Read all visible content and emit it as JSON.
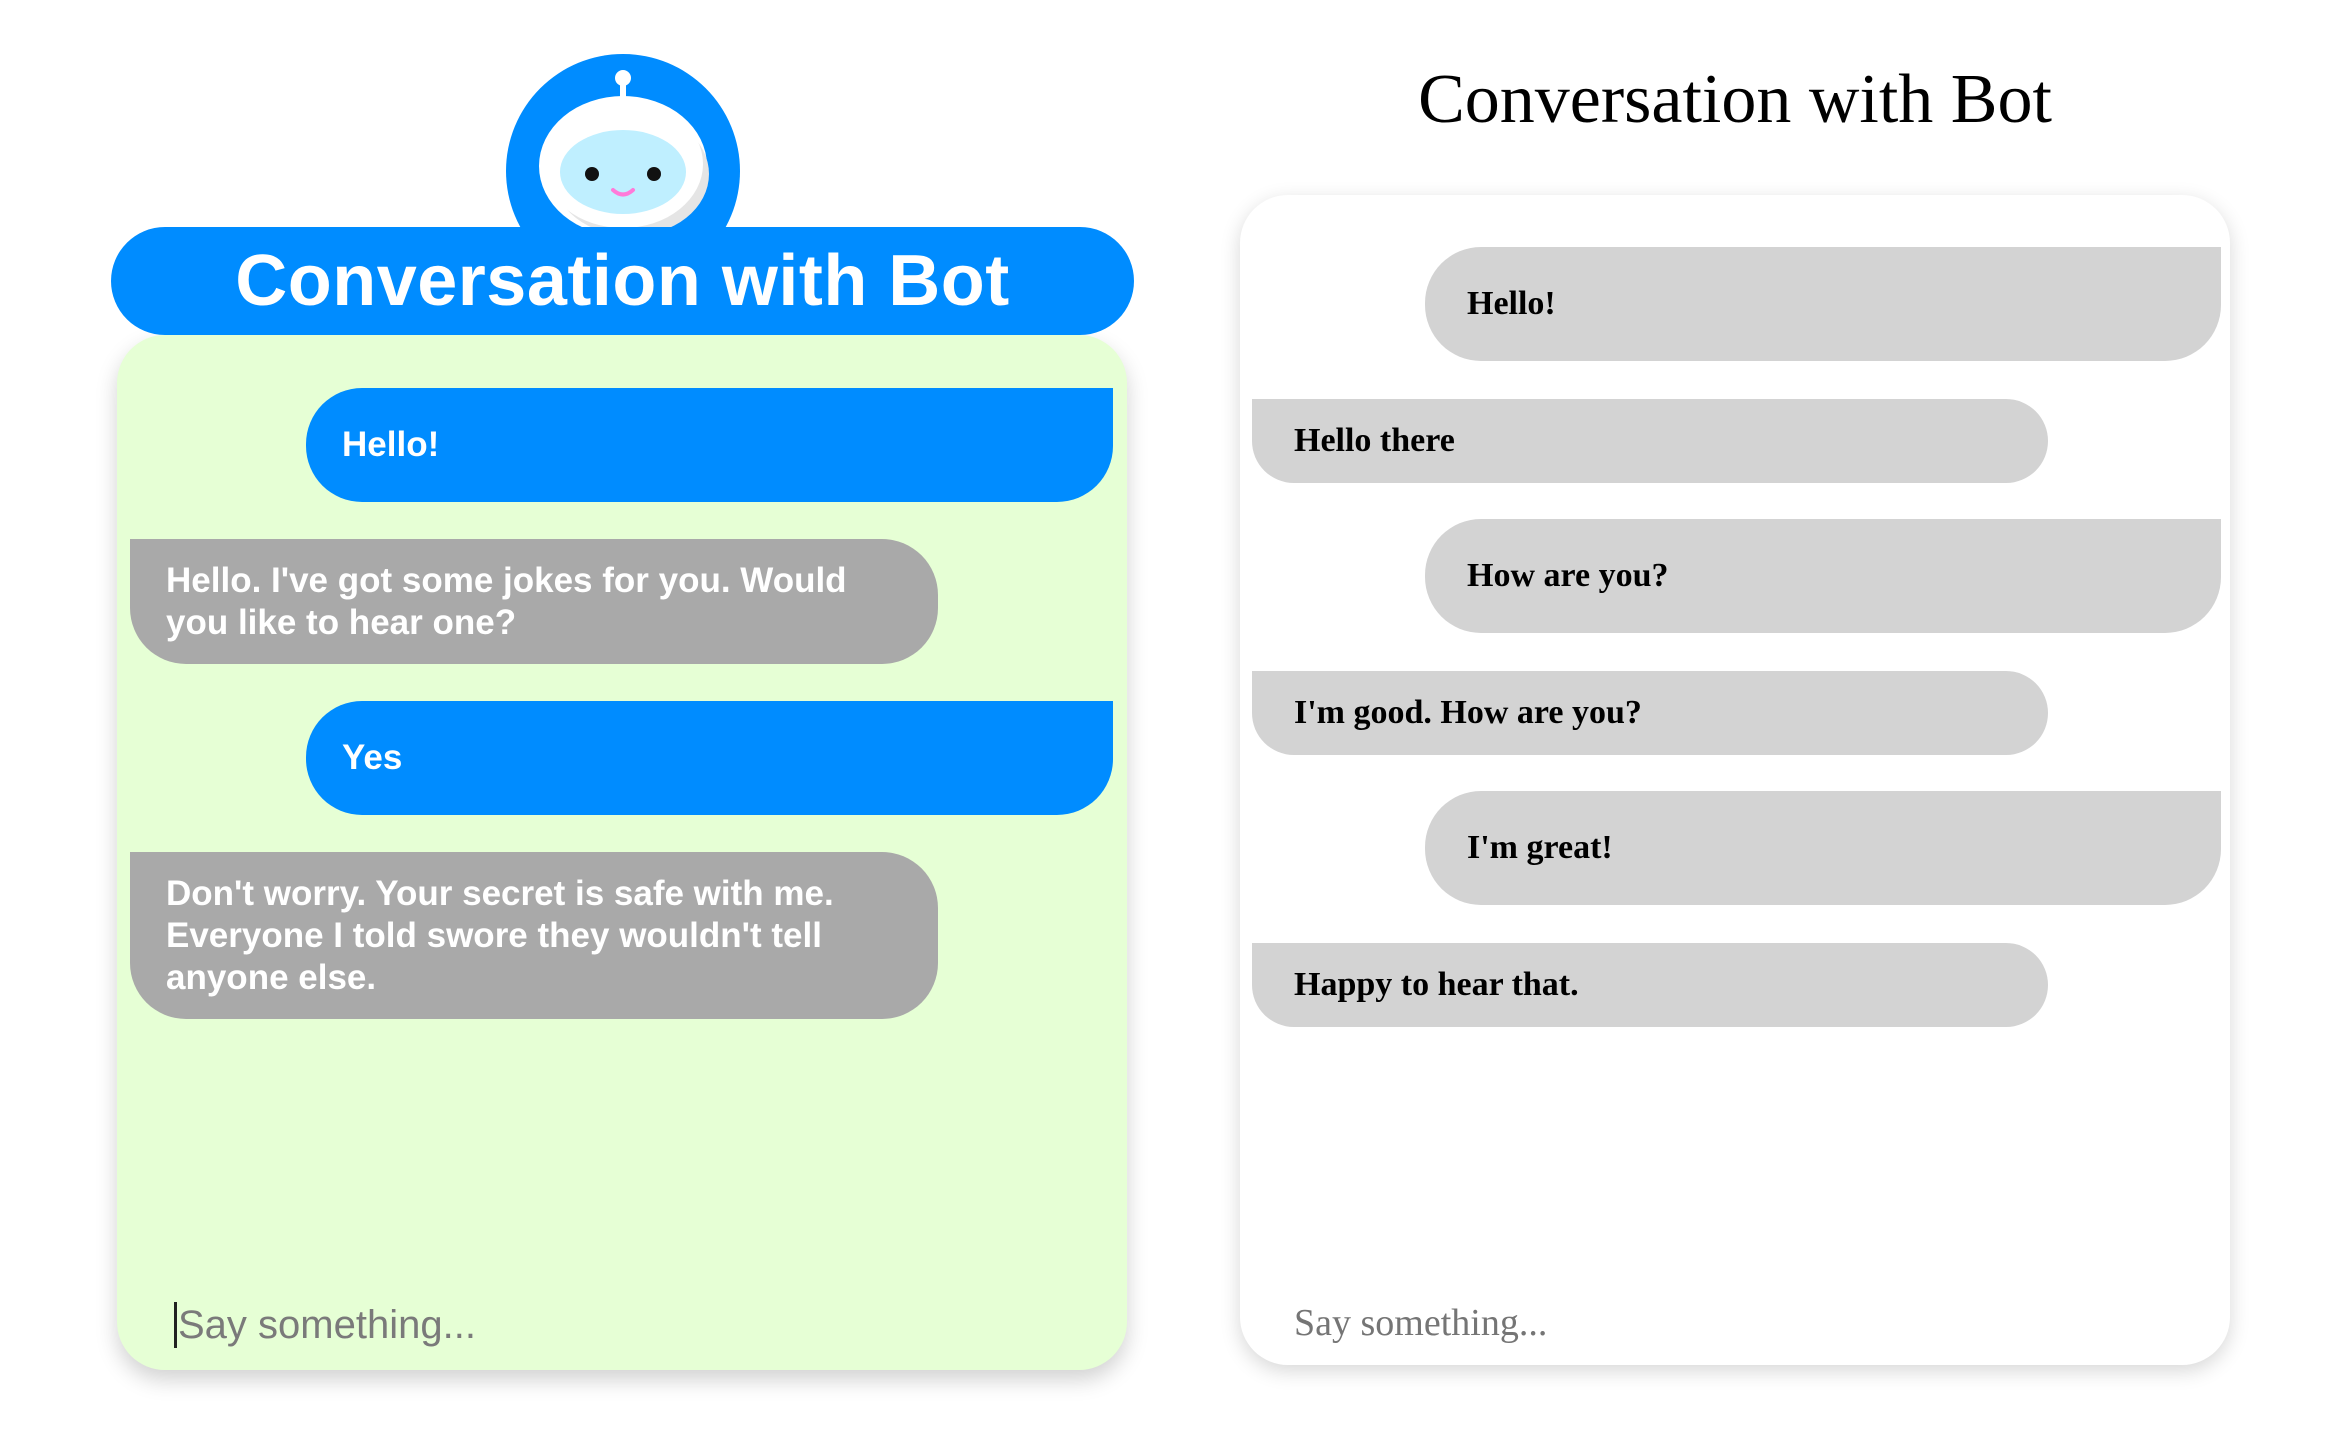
{
  "styled_chat": {
    "title": "Conversation with Bot",
    "avatar_icon": "robot-icon",
    "messages": [
      {
        "sender": "user",
        "text": "Hello!"
      },
      {
        "sender": "bot",
        "lines": [
          "Hello. I've got some jokes for you. Would",
          "you like to hear one?"
        ]
      },
      {
        "sender": "user",
        "text": "Yes"
      },
      {
        "sender": "bot",
        "lines": [
          "Don't worry. Your secret is safe with me.",
          "Everyone I told swore they wouldn't tell",
          "anyone else."
        ]
      }
    ],
    "input": {
      "placeholder": "Say something...",
      "value": ""
    },
    "colors": {
      "accent": "#008cff",
      "panel_bg": "#e6ffd5",
      "bot_bubble": "#a9a9a9",
      "user_bubble": "#008cff"
    }
  },
  "plain_chat": {
    "title": "Conversation with Bot",
    "messages": [
      {
        "sender": "user",
        "text": "Hello!"
      },
      {
        "sender": "bot",
        "text": "Hello there"
      },
      {
        "sender": "user",
        "text": "How are you?"
      },
      {
        "sender": "bot",
        "text": "I'm good. How are you?"
      },
      {
        "sender": "user",
        "text": "I'm great!"
      },
      {
        "sender": "bot",
        "text": "Happy to hear that."
      }
    ],
    "input": {
      "placeholder": "Say something...",
      "value": ""
    },
    "colors": {
      "bubble": "#d3d3d3"
    }
  }
}
